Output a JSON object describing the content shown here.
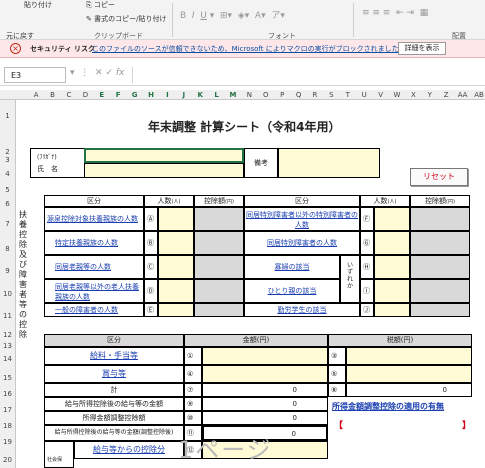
{
  "ribbon": {
    "paste_label": "貼り付け",
    "copy_label": "コピー",
    "format_painter_label": "書式のコピー/貼り付け",
    "undo_label": "元に戻す",
    "clipboard_group": "クリップボード",
    "font_group": "フォント",
    "align_group": "配置"
  },
  "security": {
    "title": "セキュリティ リスク",
    "message": "このファイルのソースが信頼できないため、Microsoft によりマクロの実行がブロックされました。",
    "button": "詳細を表示"
  },
  "formula_bar": {
    "name_box": "E3",
    "fx": "fx"
  },
  "columns": [
    "A",
    "B",
    "C",
    "D",
    "E",
    "F",
    "G",
    "H",
    "I",
    "J",
    "K",
    "L",
    "M",
    "N",
    "O",
    "P",
    "Q",
    "R",
    "S",
    "T",
    "U",
    "V",
    "W",
    "X",
    "Y",
    "Z",
    "AA",
    "AB"
  ],
  "selected_columns": [
    "E",
    "F",
    "G",
    "H",
    "I",
    "J",
    "K",
    "L",
    "M"
  ],
  "rows": [
    "1",
    "2",
    "3",
    "4",
    "5",
    "6",
    "7",
    "8",
    "9",
    "10",
    "11",
    "12",
    "13",
    "14",
    "15",
    "16",
    "17",
    "18",
    "19",
    "20"
  ],
  "sheet": {
    "title": "年末調整 計算シート（令和4年用）",
    "furigana": "(ﾌﾘｶﾞﾅ)",
    "name_label": "氏　名",
    "remarks_label": "備考",
    "reset_button": "リセット",
    "dep_header": {
      "kubun": "区分",
      "ninzu": "人数",
      "unit_people": "(人)",
      "koujo": "控除額",
      "unit_yen": "(円)"
    },
    "left_rows": [
      {
        "label": "源泉控除対象扶養親族の人数",
        "mark": "Ⓐ"
      },
      {
        "label": "特定扶養親族の人数",
        "mark": "Ⓑ"
      },
      {
        "label": "同居老親等の人数",
        "mark": "Ⓒ"
      },
      {
        "label": "同居老親等以外の老人扶養親族の人数",
        "mark": "Ⓓ"
      },
      {
        "label": "一般の障害者の人数",
        "mark": "Ⓔ"
      }
    ],
    "right_rows": [
      {
        "label": "同居特別障害者以外の特別障害者の人数",
        "mark": "Ⓕ"
      },
      {
        "label": "同居特別障害者の人数",
        "mark": "Ⓖ"
      },
      {
        "label": "寡婦の該当",
        "mark": "Ⓗ"
      },
      {
        "label": "ひとり親の該当",
        "mark": "Ⓘ"
      },
      {
        "label": "勤労学生の該当",
        "mark": "Ⓙ"
      }
    ],
    "side_label": "扶養控除及び障害者等の控除",
    "izureka": "いずれか",
    "amt_header": {
      "kubun": "区分",
      "kingaku": "金額(円)",
      "zeigaku": "税額(円)"
    },
    "amt_rows": [
      {
        "label": "給料・手当等",
        "m1": "①",
        "v1": "",
        "m2": "③",
        "v2": ""
      },
      {
        "label": "賞与等",
        "m1": "④",
        "v1": "",
        "m2": "⑤",
        "v2": ""
      },
      {
        "label": "計",
        "m1": "⑦",
        "v1": "0",
        "m2": "⑧",
        "v2": "0"
      },
      {
        "label": "給与所得控除後の給与等の金額",
        "m1": "⑨",
        "v1": "0"
      },
      {
        "label": "所得金額調整控除額",
        "m1": "⑩",
        "v1": "0"
      },
      {
        "label": "給与所得控除後の給与等の金額(調整控除後)",
        "m1": "⑪",
        "v1": "0"
      },
      {
        "label": "給与等からの控除分",
        "m1": "⑫",
        "v1": ""
      }
    ],
    "adjust_title": "所得金額調整控除の適用の有無",
    "bracket_l": "【",
    "bracket_r": "】",
    "shakai": "社会保",
    "watermark": "1ページ"
  }
}
